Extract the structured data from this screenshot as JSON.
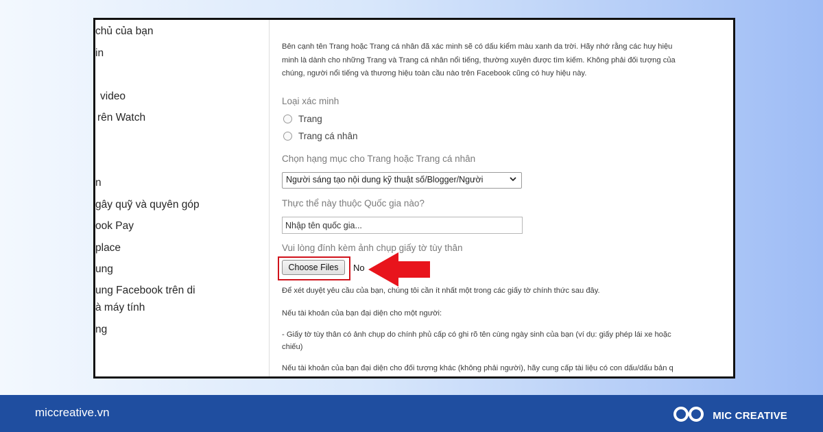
{
  "sidebar": {
    "items": [
      "chủ của bạn",
      "in",
      "video",
      "rên Watch",
      "n",
      "gây quỹ và quyên góp",
      "ook Pay",
      "place",
      "ung",
      "ung Facebook trên di",
      "à máy tính",
      "ng"
    ]
  },
  "form": {
    "intro": [
      "Bên cạnh tên Trang hoặc Trang cá nhân đã xác minh sẽ có dấu kiểm màu xanh da trời. Hãy nhớ rằng các huy hiệu",
      "minh là dành cho những Trang và Trang cá nhân nổi tiếng, thường xuyên được tìm kiếm. Không phải đối tượng của",
      "chúng, người nổi tiếng và thương hiệu toàn cầu nào trên Facebook cũng có huy hiệu này."
    ],
    "verification_type_label": "Loại xác minh",
    "radio_page": "Trang",
    "radio_profile": "Trang cá nhân",
    "category_label": "Chọn hạng mục cho Trang hoặc Trang cá nhân",
    "category_value": "Người sáng tạo nội dung kỹ thuật số/Blogger/Người",
    "country_label": "Thực thể này thuộc Quốc gia nào?",
    "country_placeholder": "Nhập tên quốc gia...",
    "attach_label": "Vui lòng đính kèm ảnh chụp giấy tờ tùy thân",
    "choose_files": "Choose Files",
    "no_file": "No",
    "doc_note": "Để xét duyệt yêu cầu của bạn, chúng tôi cần ít nhất một trong các giấy tờ chính thức sau đây.",
    "person_note": "Nếu tài khoản của bạn đại diện cho một người:",
    "id_note_1": "- Giấy tờ tùy thân có ảnh chụp do chính phủ cấp có ghi rõ tên cùng ngày sinh của bạn (ví dụ: giấy phép lái xe hoặc",
    "id_note_2": "chiếu)",
    "entity_note": "Nếu tài khoản của bạn đại diện cho đối tượng khác (không phải người), hãy cung cấp tài liệu có con dấu/dấu bản q"
  },
  "footer": {
    "url": "miccreative.vn",
    "brand": "MIC CREATIVE"
  },
  "colors": {
    "highlight": "#d0121b",
    "footer_bg": "#1f4ea0"
  },
  "icons": [
    "chevron-down-icon",
    "red-arrow-icon",
    "mic-creative-logo-icon"
  ]
}
